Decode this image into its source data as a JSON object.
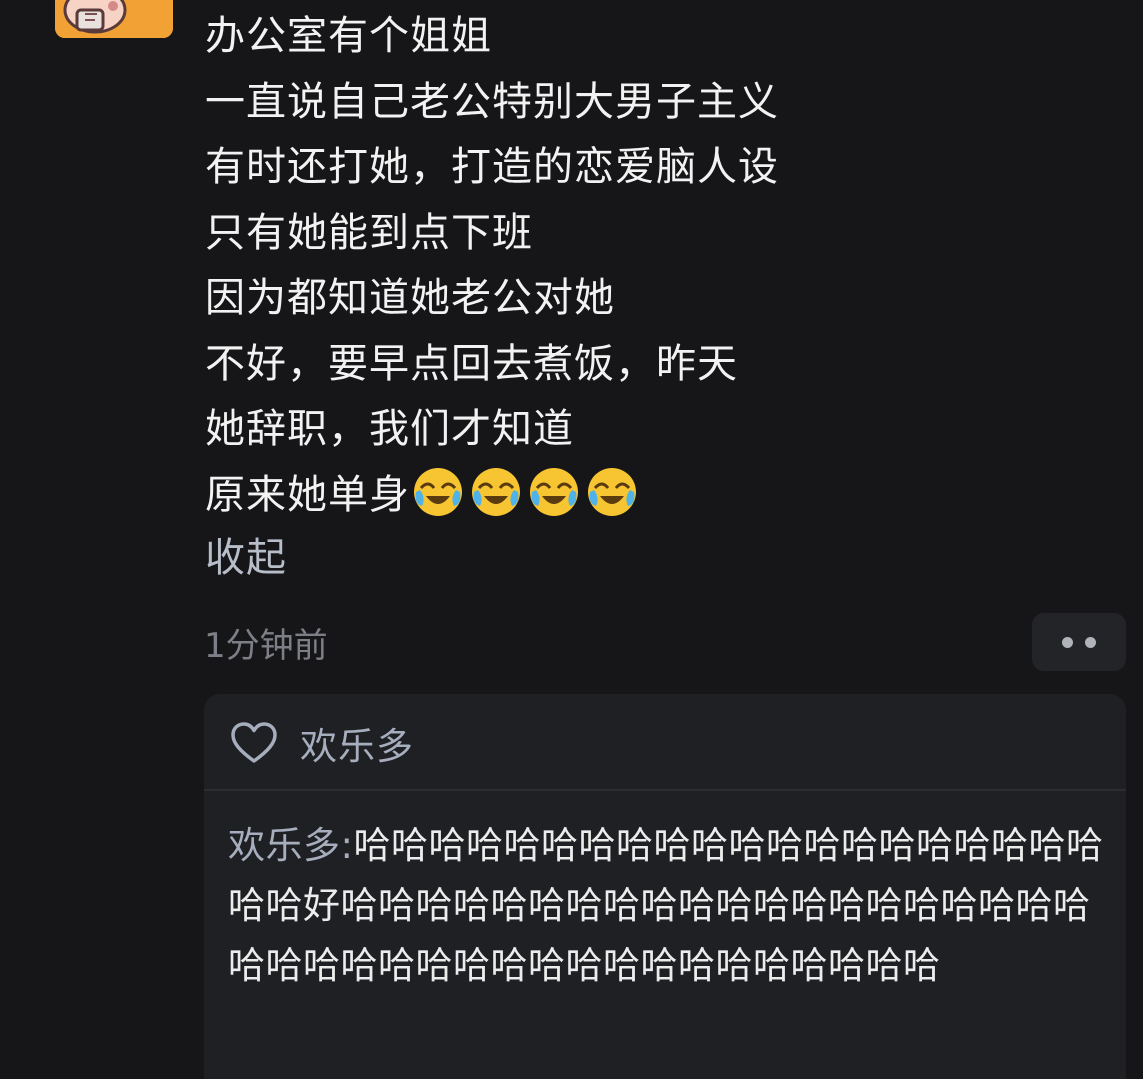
{
  "post": {
    "lines": [
      "办公室有个姐姐",
      "一直说自己老公特别大男子主义",
      "有时还打她，打造的恋爱脑人设",
      "只有她能到点下班",
      "因为都知道她老公对她",
      "不好，要早点回去煮饭，昨天",
      "她辞职，我们才知道",
      "原来她单身"
    ],
    "emojis": [
      "crying-laughing-emoji",
      "crying-laughing-emoji",
      "crying-laughing-emoji",
      "crying-laughing-emoji"
    ],
    "collapse_label": "收起",
    "timestamp": "1分钟前"
  },
  "reply_section": {
    "liker_name": "欢乐多",
    "reply": {
      "author": "欢乐多:",
      "text": "哈哈哈哈哈哈哈哈哈哈哈哈哈哈哈哈哈哈哈哈哈哈好哈哈哈哈哈哈哈哈哈哈哈哈哈哈哈哈哈哈哈哈哈哈哈哈哈哈哈哈哈哈哈哈哈哈哈哈哈哈哈"
    }
  },
  "colors": {
    "background": "#161618",
    "post_text": "#f2f2f2",
    "muted": "#7c7f86",
    "link": "#b7bdc9",
    "reply_box": "#1f2023",
    "avatar": "#f2a234"
  }
}
